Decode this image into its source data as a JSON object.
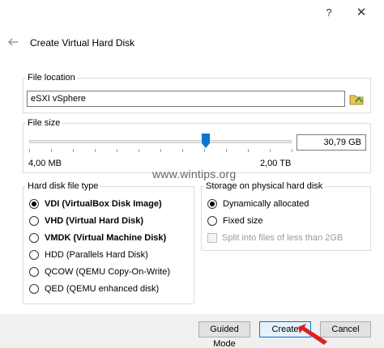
{
  "window": {
    "help_symbol": "?",
    "close_symbol": "✕",
    "title": "Create Virtual Hard Disk"
  },
  "file_location": {
    "label": "File location",
    "value": "eSXI vSphere",
    "folder_icon": "folder-icon"
  },
  "file_size": {
    "label": "File size",
    "value": "30,79 GB",
    "min_label": "4,00 MB",
    "max_label": "2,00 TB",
    "slider_fraction": 0.67
  },
  "watermark": "www.wintips.org",
  "disk_type": {
    "label": "Hard disk file type",
    "options": [
      {
        "label": "VDI (VirtualBox Disk Image)",
        "selected": true
      },
      {
        "label": "VHD (Virtual Hard Disk)",
        "selected": false
      },
      {
        "label": "VMDK (Virtual Machine Disk)",
        "selected": false
      },
      {
        "label": "HDD (Parallels Hard Disk)",
        "selected": false
      },
      {
        "label": "QCOW (QEMU Copy-On-Write)",
        "selected": false
      },
      {
        "label": "QED (QEMU enhanced disk)",
        "selected": false
      }
    ]
  },
  "storage": {
    "label": "Storage on physical hard disk",
    "options": [
      {
        "label": "Dynamically allocated",
        "selected": true
      },
      {
        "label": "Fixed size",
        "selected": false
      }
    ],
    "split_label": "Split into files of less than 2GB"
  },
  "buttons": {
    "guided": "Guided Mode",
    "create": "Create",
    "cancel": "Cancel"
  },
  "colors": {
    "accent": "#0078d7",
    "annotation": "#e02020"
  }
}
